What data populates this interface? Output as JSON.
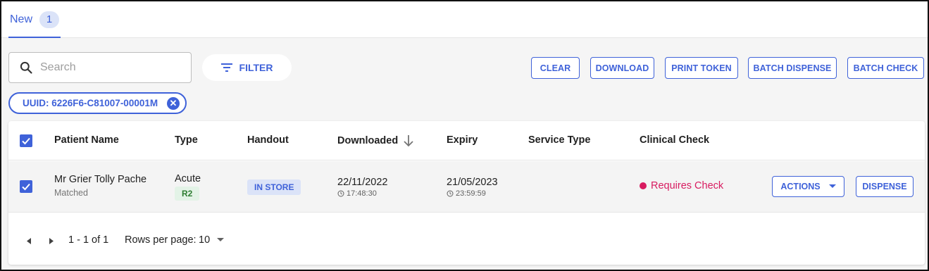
{
  "tabs": [
    {
      "label": "New",
      "count": "1"
    }
  ],
  "search": {
    "placeholder": "Search",
    "value": ""
  },
  "toolbar": {
    "filter_label": "FILTER",
    "clear_label": "CLEAR",
    "download_label": "DOWNLOAD",
    "print_token_label": "PRINT TOKEN",
    "batch_dispense_label": "BATCH DISPENSE",
    "batch_check_label": "BATCH CHECK"
  },
  "filter_chip": {
    "label": "UUID: 6226F6-C81007-00001M"
  },
  "table": {
    "columns": {
      "patient_name": "Patient Name",
      "type": "Type",
      "handout": "Handout",
      "downloaded": "Downloaded",
      "expiry": "Expiry",
      "service_type": "Service Type",
      "clinical_check": "Clinical Check"
    },
    "sort": {
      "column": "downloaded",
      "direction": "descending"
    },
    "header_checked": true,
    "rows": [
      {
        "checked": true,
        "patient_name": "Mr Grier Tolly Pache",
        "patient_status": "Matched",
        "type": "Acute",
        "type_badge": "R2",
        "handout": "IN STORE",
        "downloaded_date": "22/11/2022",
        "downloaded_time": "17:48:30",
        "expiry_date": "21/05/2023",
        "expiry_time": "23:59:59",
        "service_type": "",
        "clinical_check": "Requires Check",
        "actions_label": "ACTIONS",
        "dispense_label": "DISPENSE"
      }
    ]
  },
  "pagination": {
    "range": "1 - 1 of 1",
    "rows_per_page_label": "Rows per page:",
    "rows_per_page": "10"
  },
  "colors": {
    "accent": "#3f62d9",
    "alert": "#d81b60",
    "success": "#2e7d32"
  }
}
